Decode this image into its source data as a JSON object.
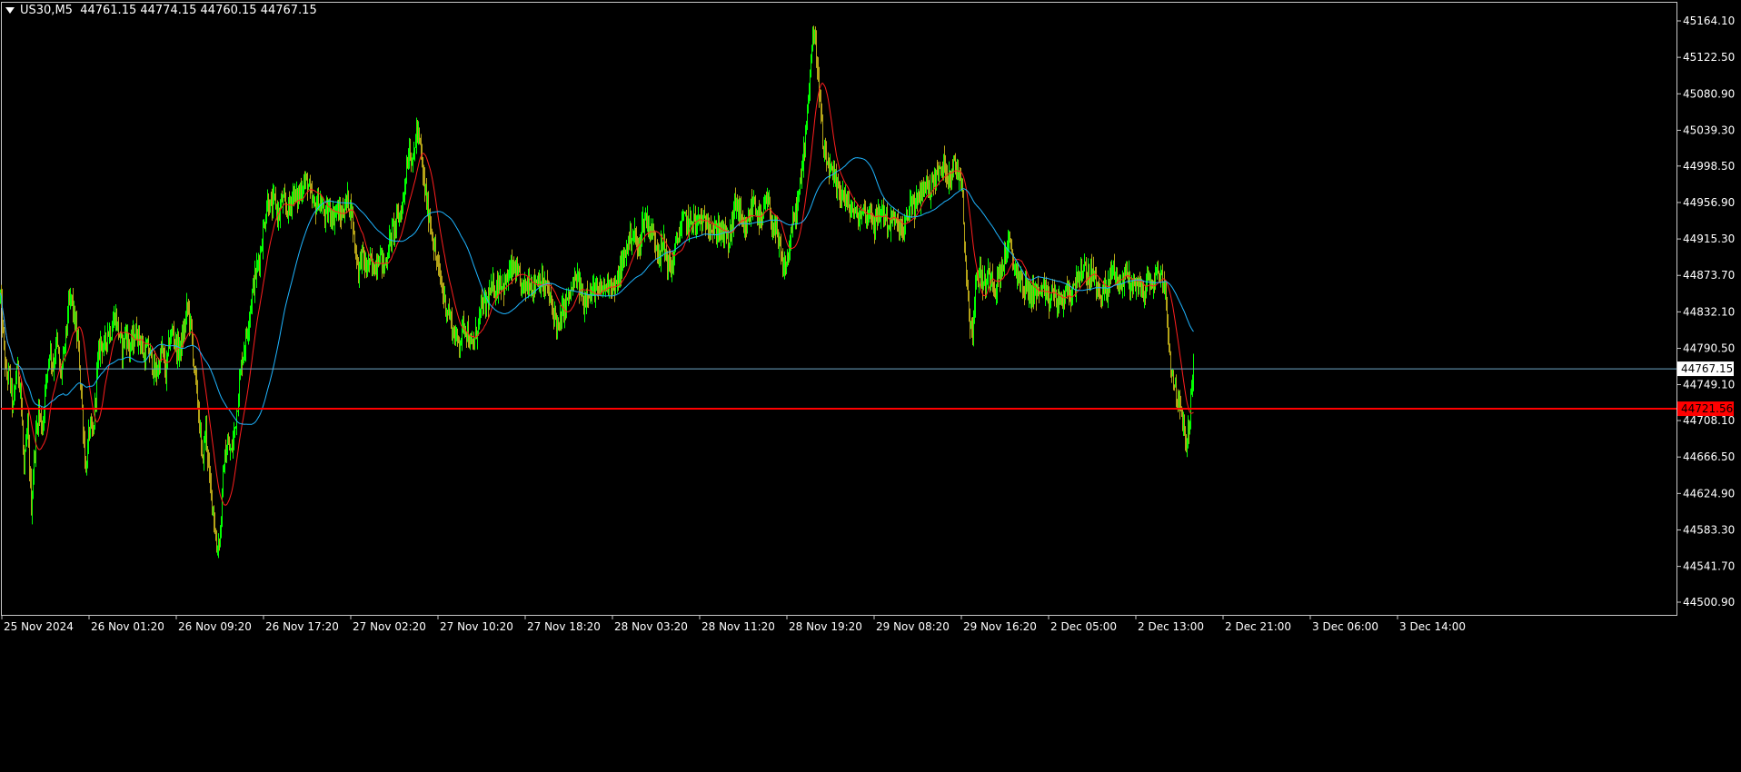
{
  "header": {
    "symbol_timeframe": "US30,M5",
    "ohlc": "44761.15 44774.15 44760.15 44767.15"
  },
  "colors": {
    "background": "#000000",
    "frame": "#c8c8c8",
    "axis_text": "#ffffff",
    "candle_up": "#00ff00",
    "candle_down": "#b5a317",
    "ma_fast": "#ff1e1e",
    "ma_slow": "#1eb4ff",
    "hline_price": "#6fa8c8",
    "hline_level": "#ff0000",
    "level_label_bg": "#ff0000",
    "price_label_bg": "#ffffff"
  },
  "chart_data": {
    "type": "candlestick",
    "symbol": "US30",
    "timeframe": "M5",
    "ylim": [
      44480,
      45185
    ],
    "y_ticks": [
      "45164.10",
      "45122.50",
      "45080.90",
      "45039.30",
      "44998.50",
      "44956.90",
      "44915.30",
      "44873.70",
      "44832.10",
      "44790.50",
      "44749.10",
      "44708.10",
      "44666.50",
      "44624.90",
      "44583.30",
      "44541.70",
      "44500.90"
    ],
    "x_ticks": [
      "25 Nov 2024",
      "26 Nov 01:20",
      "26 Nov 09:20",
      "26 Nov 17:20",
      "27 Nov 02:20",
      "27 Nov 10:20",
      "27 Nov 18:20",
      "28 Nov 03:20",
      "28 Nov 11:20",
      "28 Nov 19:20",
      "29 Nov 08:20",
      "29 Nov 16:20",
      "2 Dec 05:00",
      "2 Dec 13:00",
      "2 Dec 21:00",
      "3 Dec 06:00",
      "3 Dec 14:00"
    ],
    "current_price": "44767.15",
    "level": "44721.56",
    "close_path": [
      [
        0,
        44850
      ],
      [
        6,
        44760
      ],
      [
        10,
        44760
      ],
      [
        14,
        44720
      ],
      [
        18,
        44770
      ],
      [
        22,
        44750
      ],
      [
        26,
        44650
      ],
      [
        30,
        44700
      ],
      [
        34,
        44610
      ],
      [
        38,
        44680
      ],
      [
        42,
        44720
      ],
      [
        46,
        44700
      ],
      [
        50,
        44750
      ],
      [
        54,
        44790
      ],
      [
        58,
        44770
      ],
      [
        62,
        44800
      ],
      [
        66,
        44760
      ],
      [
        70,
        44780
      ],
      [
        74,
        44830
      ],
      [
        78,
        44850
      ],
      [
        82,
        44820
      ],
      [
        86,
        44790
      ],
      [
        90,
        44720
      ],
      [
        94,
        44650
      ],
      [
        98,
        44700
      ],
      [
        102,
        44690
      ],
      [
        106,
        44760
      ],
      [
        110,
        44800
      ],
      [
        114,
        44790
      ],
      [
        118,
        44810
      ],
      [
        122,
        44810
      ],
      [
        126,
        44830
      ],
      [
        130,
        44810
      ],
      [
        134,
        44790
      ],
      [
        138,
        44810
      ],
      [
        142,
        44790
      ],
      [
        146,
        44800
      ],
      [
        150,
        44810
      ],
      [
        154,
        44800
      ],
      [
        158,
        44780
      ],
      [
        162,
        44790
      ],
      [
        166,
        44780
      ],
      [
        170,
        44760
      ],
      [
        174,
        44770
      ],
      [
        178,
        44790
      ],
      [
        182,
        44760
      ],
      [
        186,
        44800
      ],
      [
        190,
        44810
      ],
      [
        194,
        44790
      ],
      [
        198,
        44790
      ],
      [
        202,
        44810
      ],
      [
        206,
        44840
      ],
      [
        210,
        44810
      ],
      [
        214,
        44760
      ],
      [
        218,
        44720
      ],
      [
        222,
        44660
      ],
      [
        226,
        44700
      ],
      [
        230,
        44640
      ],
      [
        234,
        44610
      ],
      [
        238,
        44560
      ],
      [
        242,
        44580
      ],
      [
        246,
        44660
      ],
      [
        250,
        44680
      ],
      [
        254,
        44670
      ],
      [
        258,
        44700
      ],
      [
        262,
        44740
      ],
      [
        266,
        44780
      ],
      [
        270,
        44800
      ],
      [
        274,
        44830
      ],
      [
        278,
        44860
      ],
      [
        282,
        44880
      ],
      [
        286,
        44900
      ],
      [
        290,
        44930
      ],
      [
        294,
        44960
      ],
      [
        298,
        44950
      ],
      [
        302,
        44960
      ],
      [
        306,
        44940
      ],
      [
        310,
        44960
      ],
      [
        314,
        44950
      ],
      [
        318,
        44950
      ],
      [
        322,
        44970
      ],
      [
        326,
        44960
      ],
      [
        330,
        44970
      ],
      [
        334,
        44980
      ],
      [
        338,
        44980
      ],
      [
        342,
        44960
      ],
      [
        346,
        44950
      ],
      [
        350,
        44960
      ],
      [
        354,
        44950
      ],
      [
        358,
        44940
      ],
      [
        362,
        44950
      ],
      [
        366,
        44940
      ],
      [
        370,
        44950
      ],
      [
        374,
        44940
      ],
      [
        378,
        44950
      ],
      [
        382,
        44960
      ],
      [
        386,
        44950
      ],
      [
        390,
        44910
      ],
      [
        394,
        44880
      ],
      [
        398,
        44900
      ],
      [
        402,
        44880
      ],
      [
        406,
        44890
      ],
      [
        410,
        44880
      ],
      [
        414,
        44890
      ],
      [
        418,
        44900
      ],
      [
        422,
        44880
      ],
      [
        426,
        44900
      ],
      [
        430,
        44920
      ],
      [
        434,
        44930
      ],
      [
        438,
        44940
      ],
      [
        442,
        44950
      ],
      [
        446,
        44990
      ],
      [
        450,
        45020
      ],
      [
        454,
        45000
      ],
      [
        458,
        45040
      ],
      [
        462,
        45020
      ],
      [
        466,
        44980
      ],
      [
        470,
        44950
      ],
      [
        474,
        44930
      ],
      [
        478,
        44900
      ],
      [
        482,
        44880
      ],
      [
        486,
        44860
      ],
      [
        490,
        44840
      ],
      [
        494,
        44830
      ],
      [
        498,
        44810
      ],
      [
        502,
        44800
      ],
      [
        506,
        44800
      ],
      [
        510,
        44820
      ],
      [
        514,
        44810
      ],
      [
        518,
        44790
      ],
      [
        522,
        44800
      ],
      [
        526,
        44820
      ],
      [
        530,
        44840
      ],
      [
        534,
        44840
      ],
      [
        538,
        44850
      ],
      [
        542,
        44860
      ],
      [
        546,
        44860
      ],
      [
        550,
        44870
      ],
      [
        554,
        44860
      ],
      [
        558,
        44870
      ],
      [
        562,
        44880
      ],
      [
        566,
        44880
      ],
      [
        570,
        44870
      ],
      [
        574,
        44860
      ],
      [
        578,
        44860
      ],
      [
        582,
        44870
      ],
      [
        586,
        44860
      ],
      [
        590,
        44870
      ],
      [
        594,
        44870
      ],
      [
        598,
        44860
      ],
      [
        602,
        44860
      ],
      [
        606,
        44840
      ],
      [
        610,
        44830
      ],
      [
        614,
        44810
      ],
      [
        618,
        44830
      ],
      [
        622,
        44840
      ],
      [
        626,
        44850
      ],
      [
        630,
        44860
      ],
      [
        634,
        44870
      ],
      [
        638,
        44860
      ],
      [
        642,
        44840
      ],
      [
        646,
        44860
      ],
      [
        650,
        44850
      ],
      [
        654,
        44860
      ],
      [
        658,
        44850
      ],
      [
        662,
        44860
      ],
      [
        666,
        44860
      ],
      [
        670,
        44870
      ],
      [
        674,
        44860
      ],
      [
        678,
        44860
      ],
      [
        682,
        44880
      ],
      [
        686,
        44890
      ],
      [
        690,
        44910
      ],
      [
        694,
        44920
      ],
      [
        698,
        44920
      ],
      [
        702,
        44900
      ],
      [
        706,
        44930
      ],
      [
        710,
        44940
      ],
      [
        714,
        44930
      ],
      [
        718,
        44920
      ],
      [
        722,
        44910
      ],
      [
        726,
        44900
      ],
      [
        730,
        44910
      ],
      [
        734,
        44890
      ],
      [
        738,
        44880
      ],
      [
        742,
        44900
      ],
      [
        746,
        44920
      ],
      [
        750,
        44930
      ],
      [
        754,
        44940
      ],
      [
        758,
        44930
      ],
      [
        762,
        44940
      ],
      [
        766,
        44930
      ],
      [
        770,
        44940
      ],
      [
        774,
        44930
      ],
      [
        778,
        44940
      ],
      [
        782,
        44930
      ],
      [
        786,
        44920
      ],
      [
        790,
        44930
      ],
      [
        794,
        44920
      ],
      [
        798,
        44920
      ],
      [
        802,
        44910
      ],
      [
        806,
        44940
      ],
      [
        810,
        44960
      ],
      [
        814,
        44940
      ],
      [
        818,
        44920
      ],
      [
        822,
        44930
      ],
      [
        826,
        44950
      ],
      [
        830,
        44960
      ],
      [
        834,
        44940
      ],
      [
        838,
        44930
      ],
      [
        842,
        44960
      ],
      [
        846,
        44950
      ],
      [
        850,
        44930
      ],
      [
        854,
        44920
      ],
      [
        858,
        44900
      ],
      [
        862,
        44880
      ],
      [
        866,
        44890
      ],
      [
        870,
        44920
      ],
      [
        874,
        44940
      ],
      [
        878,
        44960
      ],
      [
        882,
        44990
      ],
      [
        886,
        45040
      ],
      [
        890,
        45090
      ],
      [
        894,
        45150
      ],
      [
        898,
        45130
      ],
      [
        902,
        45070
      ],
      [
        906,
        45010
      ],
      [
        910,
        45000
      ],
      [
        914,
        44990
      ],
      [
        918,
        44980
      ],
      [
        922,
        44970
      ],
      [
        926,
        44970
      ],
      [
        930,
        44960
      ],
      [
        934,
        44950
      ],
      [
        938,
        44950
      ],
      [
        942,
        44940
      ],
      [
        946,
        44940
      ],
      [
        950,
        44950
      ],
      [
        954,
        44940
      ],
      [
        958,
        44950
      ],
      [
        962,
        44930
      ],
      [
        966,
        44940
      ],
      [
        970,
        44950
      ],
      [
        974,
        44940
      ],
      [
        978,
        44930
      ],
      [
        982,
        44940
      ],
      [
        986,
        44930
      ],
      [
        990,
        44930
      ],
      [
        994,
        44920
      ],
      [
        998,
        44940
      ],
      [
        1002,
        44960
      ],
      [
        1006,
        44950
      ],
      [
        1010,
        44960
      ],
      [
        1014,
        44970
      ],
      [
        1018,
        44980
      ],
      [
        1022,
        44970
      ],
      [
        1026,
        44980
      ],
      [
        1030,
        44990
      ],
      [
        1034,
        44990
      ],
      [
        1038,
        45000
      ],
      [
        1042,
        44990
      ],
      [
        1046,
        44990
      ],
      [
        1050,
        45000
      ],
      [
        1054,
        44990
      ],
      [
        1058,
        44990
      ],
      [
        1062,
        44890
      ],
      [
        1066,
        44830
      ],
      [
        1070,
        44810
      ],
      [
        1074,
        44870
      ],
      [
        1078,
        44880
      ],
      [
        1082,
        44860
      ],
      [
        1086,
        44870
      ],
      [
        1090,
        44880
      ],
      [
        1094,
        44860
      ],
      [
        1098,
        44870
      ],
      [
        1102,
        44880
      ],
      [
        1106,
        44900
      ],
      [
        1110,
        44910
      ],
      [
        1114,
        44890
      ],
      [
        1118,
        44880
      ],
      [
        1122,
        44870
      ],
      [
        1126,
        44860
      ],
      [
        1130,
        44860
      ],
      [
        1134,
        44850
      ],
      [
        1138,
        44860
      ],
      [
        1142,
        44850
      ],
      [
        1146,
        44860
      ],
      [
        1150,
        44850
      ],
      [
        1154,
        44840
      ],
      [
        1158,
        44860
      ],
      [
        1162,
        44840
      ],
      [
        1166,
        44850
      ],
      [
        1170,
        44840
      ],
      [
        1174,
        44860
      ],
      [
        1178,
        44850
      ],
      [
        1182,
        44860
      ],
      [
        1186,
        44880
      ],
      [
        1190,
        44870
      ],
      [
        1194,
        44880
      ],
      [
        1198,
        44870
      ],
      [
        1202,
        44880
      ],
      [
        1206,
        44860
      ],
      [
        1210,
        44850
      ],
      [
        1214,
        44860
      ],
      [
        1218,
        44850
      ],
      [
        1222,
        44880
      ],
      [
        1226,
        44880
      ],
      [
        1230,
        44870
      ],
      [
        1234,
        44860
      ],
      [
        1238,
        44880
      ],
      [
        1242,
        44870
      ],
      [
        1246,
        44860
      ],
      [
        1250,
        44870
      ],
      [
        1254,
        44860
      ],
      [
        1258,
        44850
      ],
      [
        1262,
        44870
      ],
      [
        1266,
        44860
      ],
      [
        1270,
        44870
      ],
      [
        1274,
        44880
      ],
      [
        1278,
        44870
      ],
      [
        1282,
        44860
      ],
      [
        1286,
        44790
      ],
      [
        1290,
        44760
      ],
      [
        1294,
        44740
      ],
      [
        1298,
        44720
      ],
      [
        1302,
        44700
      ],
      [
        1306,
        44680
      ],
      [
        1310,
        44730
      ],
      [
        1313,
        44767
      ]
    ]
  }
}
